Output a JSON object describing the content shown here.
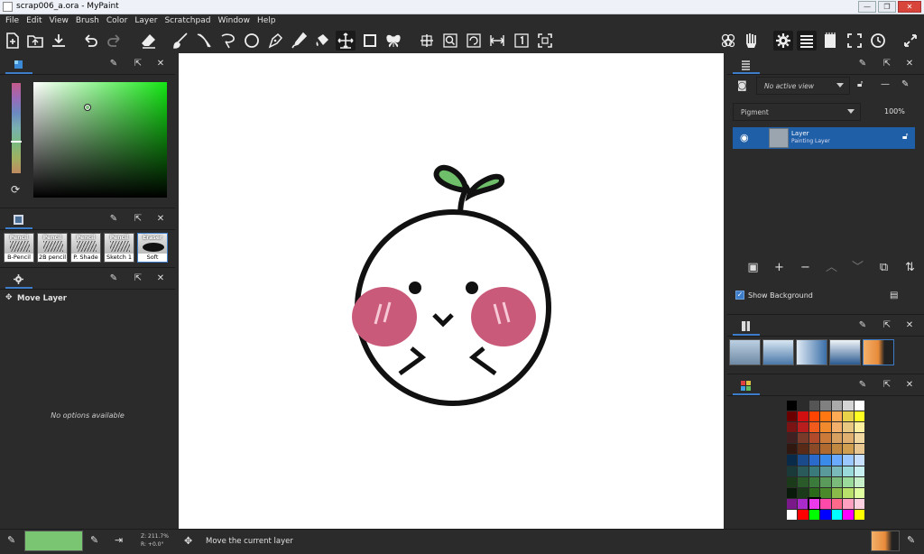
{
  "window": {
    "title": "scrap006_a.ora - MyPaint",
    "min": "—",
    "max": "❐",
    "close": "✕"
  },
  "menu": [
    "File",
    "Edit",
    "View",
    "Brush",
    "Color",
    "Layer",
    "Scratchpad",
    "Window",
    "Help"
  ],
  "toolbar": {
    "left": [
      "new-document-icon",
      "open-folder-icon",
      "save-icon",
      "undo-icon",
      "redo-icon",
      "eraser-icon",
      "freehand-brush-icon",
      "inking-icon",
      "lasso-icon",
      "ellipse-icon",
      "pen-nib-icon",
      "color-picker-icon",
      "fill-bucket-icon",
      "move-layer-icon",
      "frame-icon",
      "symmetry-butterfly-icon"
    ],
    "view": [
      "pan-view-icon",
      "zoom-view-icon",
      "rotate-view-icon",
      "flip-view-icon",
      "reset-view-icon",
      "fit-view-icon"
    ],
    "right": [
      "color-history-icon",
      "brush-groups-icon",
      "settings-icon",
      "layers-menu-icon",
      "scratchpad-icon",
      "fullscreen-icon",
      "clock-icon",
      "expand-icon"
    ]
  },
  "left_panels": {
    "color": {
      "tab_icon": "color-picker-tab-icon"
    },
    "brushes": {
      "items": [
        {
          "top": "Pencil",
          "label": "B-Pencil"
        },
        {
          "top": "Pencil",
          "label": "2B pencil"
        },
        {
          "top": "Pencil",
          "label": "P. Shade"
        },
        {
          "top": "Pencil",
          "label": "Sketch 1"
        },
        {
          "top": "Eraser",
          "label": "Soft"
        }
      ]
    },
    "tool_options": {
      "tool_name": "Move Layer",
      "empty_text": "No options available"
    }
  },
  "layers_panel": {
    "view_dropdown": "No active view",
    "mode_dropdown": "Pigment",
    "opacity": "100%",
    "layers": [
      {
        "name": "Layer",
        "type": "Painting Layer",
        "visible": true,
        "selected": true
      }
    ],
    "show_background_label": "Show Background",
    "show_background_checked": true
  },
  "status": {
    "zoom": "Z: 211.7%",
    "rotation": "R: +0.0°",
    "message": "Move the current layer"
  },
  "colors": {
    "current_color": "#79c572",
    "accent": "#1f5fa8",
    "palette": [
      "#000000",
      "#2b2b2b",
      "#555555",
      "#808080",
      "#aaaaaa",
      "#d5d5d5",
      "#ffffff",
      "#6b0000",
      "#d01010",
      "#ff4400",
      "#ff7711",
      "#ffaa55",
      "#e8d24a",
      "#ffff22",
      "#7a1414",
      "#b81e1e",
      "#f05a1c",
      "#f08a2c",
      "#f3b06c",
      "#e8c880",
      "#fff0a0",
      "#402020",
      "#7a3a2a",
      "#b04a2a",
      "#cc7a3a",
      "#d8a060",
      "#e0b070",
      "#f0d8a0",
      "#301810",
      "#5a2a18",
      "#8a4a28",
      "#b06a30",
      "#c08840",
      "#d0a050",
      "#e8c890",
      "#0a2a4a",
      "#1a4a8a",
      "#2a6aca",
      "#3a8aea",
      "#6aaaff",
      "#9ac8ff",
      "#c8e0ff",
      "#1a3a3a",
      "#2a5a5a",
      "#3a7a7a",
      "#5a9a9a",
      "#7ababa",
      "#9adada",
      "#c8f0f0",
      "#1a3a1a",
      "#2a5a2a",
      "#3a7a3a",
      "#5a9a5a",
      "#7aba7a",
      "#9ada9a",
      "#c8f0c8",
      "#0a1a0a",
      "#1a3a1a",
      "#2a6a1a",
      "#4a8a2a",
      "#8aba4a",
      "#b8e06a",
      "#e0ffa0",
      "#7a1a8a",
      "#aa2aca",
      "#ea3aea",
      "#ff4aaa",
      "#ff6a8a",
      "#ffa0c0",
      "#ffd0e0",
      "#ffffff",
      "#ff0000",
      "#00ff00",
      "#0000ff",
      "#00ffff",
      "#ff00ff",
      "#ffff00"
    ]
  }
}
